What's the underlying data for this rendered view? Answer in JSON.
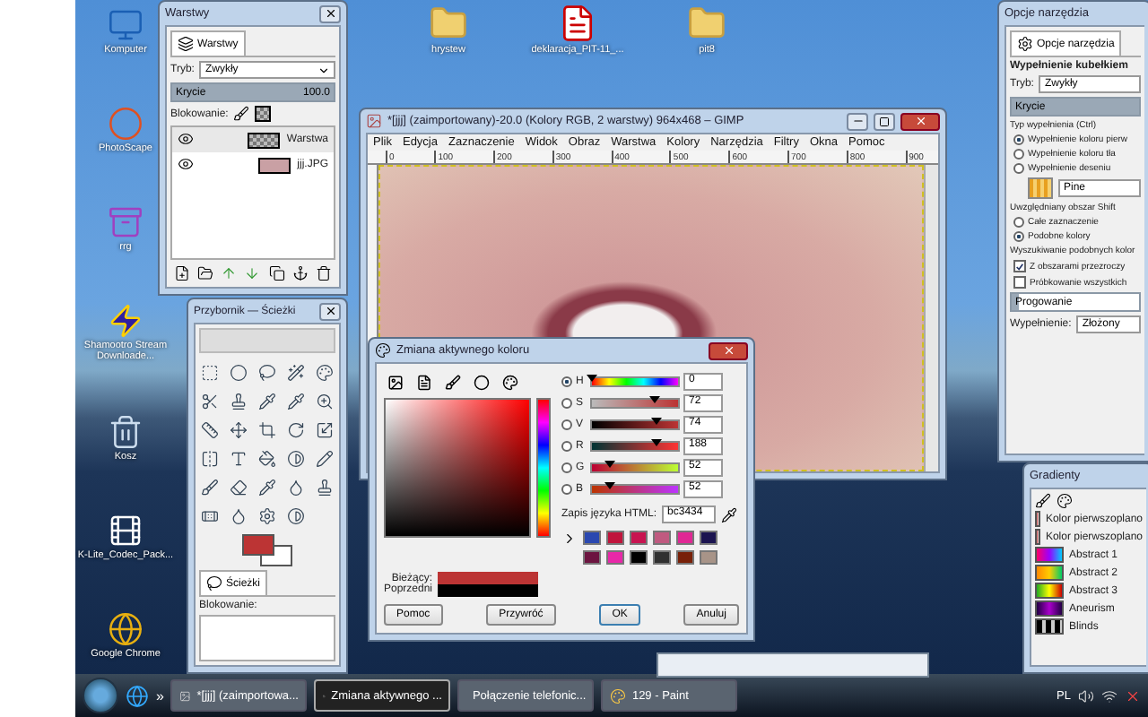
{
  "desktop_icons": [
    {
      "label": "Komputer",
      "kind": "computer"
    },
    {
      "label": "PhotoScape",
      "kind": "photoscape"
    },
    {
      "label": "rrg",
      "kind": "archive"
    },
    {
      "label": "Shamootro Stream Downloade...",
      "kind": "bolt"
    },
    {
      "label": "Kosz",
      "kind": "bin"
    },
    {
      "label": "K-Lite_Codec_Pack...",
      "kind": "codec"
    },
    {
      "label": "Google Chrome",
      "kind": "chrome"
    }
  ],
  "top_icons": [
    {
      "label": "hrystew",
      "kind": "folder"
    },
    {
      "label": "deklaracja_PIT-11_...",
      "kind": "pdf"
    },
    {
      "label": "pit8",
      "kind": "folder"
    }
  ],
  "layers_window": {
    "title": "Warstwy",
    "tab": "Warstwy",
    "mode_label": "Tryb:",
    "mode": "Zwykły",
    "opacity": {
      "label": "Krycie",
      "value": "100.0",
      "level": 1
    },
    "lock_label": "Blokowanie:",
    "layers": [
      {
        "name": "Warstwa",
        "visible": true,
        "selected": true,
        "kind": "transparent"
      },
      {
        "name": "jjj.JPG",
        "visible": true,
        "selected": false,
        "kind": "photo"
      }
    ]
  },
  "toolbox": {
    "title": "Przybornik — Ścieżki",
    "tab": "Ścieżki",
    "lock_label": "Blokowanie:",
    "colors": [
      {
        "kind": "fg",
        "color": "#bc3434"
      },
      {
        "kind": "bg",
        "color": "#ffffff"
      }
    ]
  },
  "image_window": {
    "title": "*[jjj] (zaimportowany)-20.0 (Kolory RGB, 2 warstwy) 964x468 – GIMP",
    "menu": [
      "Plik",
      "Edycja",
      "Zaznaczenie",
      "Widok",
      "Obraz",
      "Warstwa",
      "Kolory",
      "Narzędzia",
      "Filtry",
      "Okna",
      "Pomoc"
    ],
    "ruler": [
      "0",
      "100",
      "200",
      "300",
      "400",
      "500",
      "600",
      "700",
      "800",
      "900"
    ]
  },
  "color_dialog": {
    "title": "Zmiana aktywnego koloru",
    "channels": [
      {
        "label": "H",
        "value": "0",
        "level": 0,
        "selected": true,
        "kind": "hue"
      },
      {
        "label": "S",
        "value": "72",
        "level": 0.72,
        "selected": false,
        "kind": "sat"
      },
      {
        "label": "V",
        "value": "74",
        "level": 0.74,
        "selected": false,
        "kind": "val"
      },
      {
        "label": "R",
        "value": "188",
        "level": 0.74,
        "selected": false,
        "kind": "red"
      },
      {
        "label": "G",
        "value": "52",
        "level": 0.2,
        "selected": false,
        "kind": "green"
      },
      {
        "label": "B",
        "value": "52",
        "level": 0.2,
        "selected": false,
        "kind": "blue"
      }
    ],
    "html_label": "Zapis języka HTML:",
    "html": "bc3434",
    "swatches": [
      {
        "color": "#2a48b0"
      },
      {
        "color": "#c0143c"
      },
      {
        "color": "#c81450"
      },
      {
        "color": "#c05a80"
      },
      {
        "color": "#e02894"
      },
      {
        "color": "#1c1450"
      },
      {
        "color": "#6c1440"
      },
      {
        "color": "#e828a8"
      },
      {
        "color": "#000000"
      },
      {
        "color": "#303030"
      },
      {
        "color": "#782008"
      },
      {
        "color": "#a89488"
      }
    ],
    "current": {
      "label": "Bieżący:",
      "color": "#bc3434"
    },
    "previous": {
      "label": "Poprzedni",
      "color": "#000000"
    },
    "buttons": [
      "Pomoc",
      "Przywróć",
      "OK",
      "Anuluj"
    ]
  },
  "tool_options": {
    "title": "Opcje narzędzia",
    "tab": "Opcje narzędzia",
    "heading": "Wypełnienie kubełkiem",
    "mode_label": "Tryb:",
    "mode": "Zwykły",
    "opacity": {
      "label": "Krycie",
      "level": 1
    },
    "fill_type_label": "Typ wypełnienia  (Ctrl)",
    "fill_types": [
      {
        "label": "Wypełnienie koloru pierw",
        "selected": true
      },
      {
        "label": "Wypełnienie koloru tła",
        "selected": false
      },
      {
        "label": "Wypełnienie deseniu",
        "selected": false
      }
    ],
    "pattern": "Pine",
    "area_label": "Uwzględniany obszar  Shift",
    "areas": [
      {
        "label": "Całe zaznaczenie",
        "selected": false
      },
      {
        "label": "Podobne kolory",
        "selected": true
      }
    ],
    "similar_label": "Wyszukiwanie podobnych kolor",
    "checks": [
      {
        "label": "Z obszarami przezroczy",
        "checked": true
      },
      {
        "label": "Próbkowanie wszystkich",
        "checked": false
      }
    ],
    "threshold": {
      "label": "Progowanie",
      "level": 0.06
    },
    "fill_by_label": "Wypełnienie:",
    "fill_by": "Złożony"
  },
  "gradients": {
    "title": "Gradienty",
    "items": [
      {
        "name": "Kolor pierwszoplano",
        "kind": "fg-bg"
      },
      {
        "name": "Kolor pierwszoplano",
        "kind": "fg-clear"
      },
      {
        "name": "Abstract 1",
        "kind": "a1"
      },
      {
        "name": "Abstract 2",
        "kind": "a2"
      },
      {
        "name": "Abstract 3",
        "kind": "a3"
      },
      {
        "name": "Aneurism",
        "kind": "an"
      },
      {
        "name": "Blinds",
        "kind": "bl"
      }
    ]
  },
  "taskbar": {
    "more": "»",
    "tasks": [
      {
        "label": "*[jjj] (zaimportowa...",
        "selected": false,
        "kind": "gimp"
      },
      {
        "label": "Zmiana aktywnego ...",
        "selected": true,
        "kind": "gimp"
      },
      {
        "label": "Połączenie telefonic...",
        "selected": false,
        "kind": "phone"
      },
      {
        "label": "129 - Paint",
        "selected": false,
        "kind": "paint"
      }
    ],
    "language": "PL"
  }
}
